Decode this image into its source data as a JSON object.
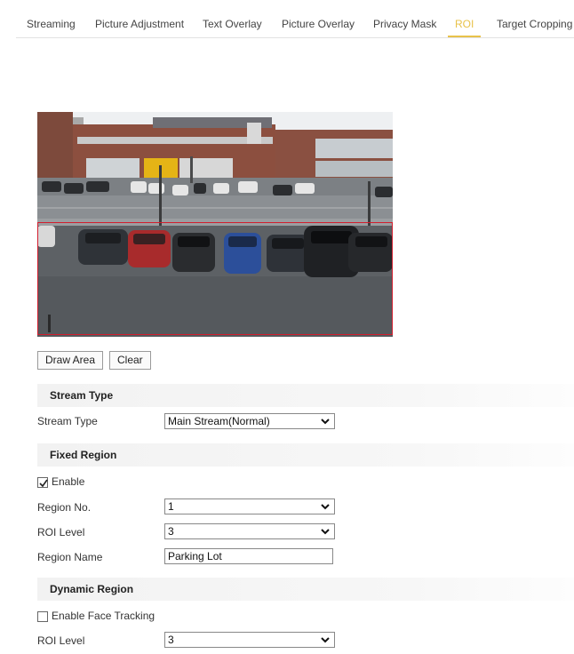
{
  "tabs": [
    {
      "label": "Streaming",
      "active": false
    },
    {
      "label": "Picture Adjustment",
      "active": false
    },
    {
      "label": "Text Overlay",
      "active": false
    },
    {
      "label": "Picture Overlay",
      "active": false
    },
    {
      "label": "Privacy Mask",
      "active": false
    },
    {
      "label": "ROI",
      "active": true
    },
    {
      "label": "Target Cropping",
      "active": false
    }
  ],
  "preview": {
    "roi_color": "#d21e2e"
  },
  "buttons": {
    "draw_area": "Draw Area",
    "clear": "Clear"
  },
  "stream_type": {
    "header": "Stream Type",
    "label": "Stream Type",
    "value": "Main Stream(Normal)"
  },
  "fixed_region": {
    "header": "Fixed Region",
    "enable_label": "Enable",
    "enable_checked": true,
    "region_no_label": "Region No.",
    "region_no_value": "1",
    "roi_level_label": "ROI Level",
    "roi_level_value": "3",
    "region_name_label": "Region Name",
    "region_name_value": "Parking Lot"
  },
  "dynamic_region": {
    "header": "Dynamic Region",
    "face_tracking_label": "Enable Face Tracking",
    "face_tracking_checked": false,
    "roi_level_label": "ROI Level",
    "roi_level_value": "3"
  },
  "colors": {
    "active_tab": "#e8c24a",
    "roi_border": "#d21e2e"
  }
}
